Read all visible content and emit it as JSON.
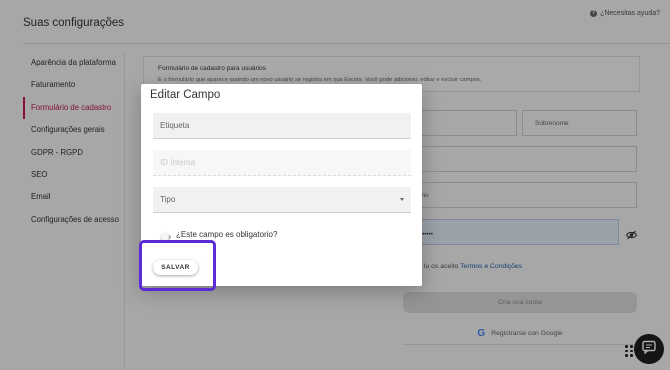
{
  "page": {
    "title": "Suas configurações",
    "help": "¿Necesitas ayuda?"
  },
  "sidebar": {
    "items": [
      {
        "label": "Aparência da plataforma"
      },
      {
        "label": "Faturamento"
      },
      {
        "label": "Formulário de cadastro",
        "active": true
      },
      {
        "label": "Configurações gerais"
      },
      {
        "label": "GDPR - RGPD"
      },
      {
        "label": "SEO"
      },
      {
        "label": "Email"
      },
      {
        "label": "Configurações de acesso"
      }
    ]
  },
  "form_card": {
    "title": "Formulário de cadastro para usuários",
    "description": "E o formulário que aparece quando um novo usuário se registra em sua Escola. Você pode adicionar, editar e excluir campos."
  },
  "background_form": {
    "name_partial": "e",
    "surname": "Sobrenome",
    "email_partial": "ail",
    "phone_partial": "fono",
    "password_partial": "na",
    "password_dots": "••••••••",
    "terms_prefix": "lu os aceito ",
    "terms_link": "Termos e Condições",
    "create_button": "Cria sua conta",
    "google_button": "Registrarse con Google"
  },
  "modal": {
    "title": "Editar Campo",
    "label_placeholder": "Etiqueta",
    "internal_id_placeholder": "ID Interna",
    "type_placeholder": "Tipo",
    "required_label": "¿Este campo es obligatorio?",
    "required_value": false,
    "save_button": "SALVAR"
  },
  "colors": {
    "accent": "#c2185b",
    "highlight": "#5b2bd6",
    "link": "#1f5fa8"
  },
  "icons": {
    "help": "help-circle-icon",
    "eye": "eye-off-icon",
    "google": "google-icon",
    "chat": "chat-icon",
    "drag": "drag-grid-icon",
    "select": "chevron-down-icon"
  }
}
